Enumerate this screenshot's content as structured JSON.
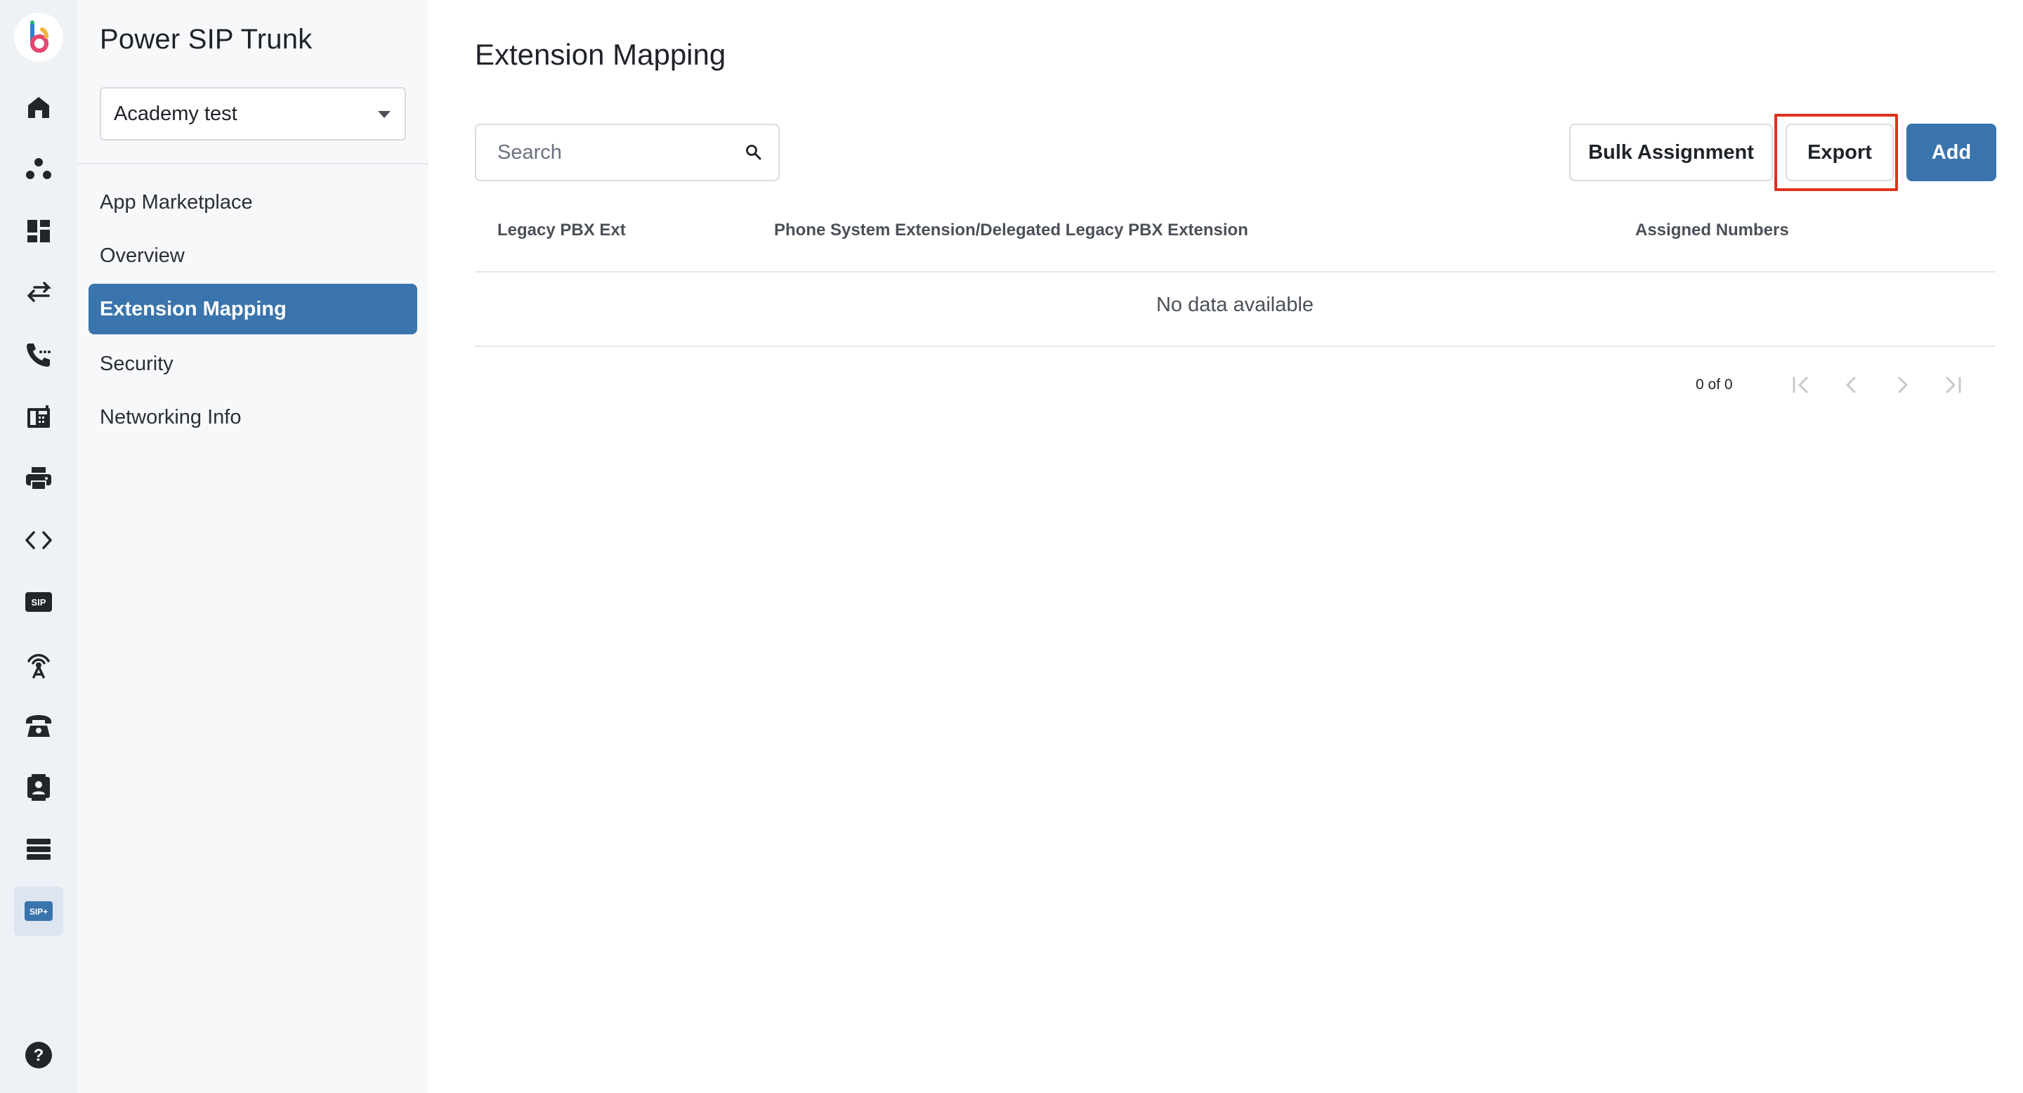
{
  "rail": {
    "icons": [
      "home-icon",
      "people-icon",
      "dashboard-icon",
      "transfer-arrows-icon",
      "phone-calls-icon",
      "fax-machine-icon",
      "printer-icon",
      "code-icon",
      "sip-icon",
      "antenna-icon",
      "desk-phone-icon",
      "contact-card-icon",
      "server-stack-icon",
      "sip-plus-icon"
    ],
    "active_icon": "sip-plus-icon",
    "sip_badge": "SIP",
    "sip_plus_badge": "SIP+",
    "help_glyph": "?"
  },
  "sidebar": {
    "title": "Power SIP Trunk",
    "account_select": {
      "value": "Academy test"
    },
    "items": [
      {
        "label": "App Marketplace",
        "active": false
      },
      {
        "label": "Overview",
        "active": false
      },
      {
        "label": "Extension Mapping",
        "active": true
      },
      {
        "label": "Security",
        "active": false
      },
      {
        "label": "Networking Info",
        "active": false
      }
    ]
  },
  "main": {
    "title": "Extension Mapping",
    "search": {
      "placeholder": "Search",
      "value": ""
    },
    "toolbar": {
      "bulk_label": "Bulk Assignment",
      "export_label": "Export",
      "add_label": "Add"
    },
    "table": {
      "columns": [
        "Legacy PBX Ext",
        "Phone System Extension/Delegated Legacy PBX Extension",
        "Assigned Numbers"
      ],
      "rows": [],
      "empty_message": "No data available"
    },
    "pagination": {
      "range_text": "0 of 0"
    }
  },
  "colors": {
    "accent": "#3a74ad",
    "highlight": "#e0311e",
    "rail_bg": "#eef1f5",
    "sidebar_bg": "#f7f8fa"
  }
}
